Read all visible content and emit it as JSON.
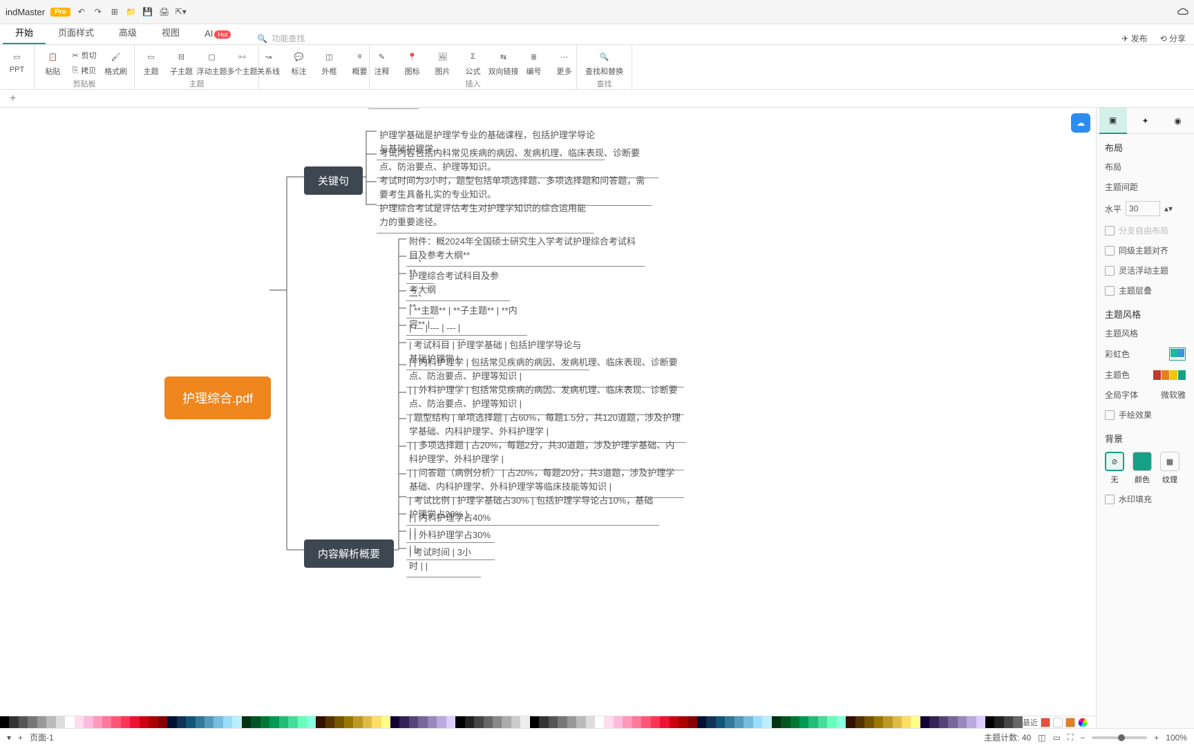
{
  "app": {
    "name": "indMaster",
    "badge": "Pro"
  },
  "menutabs": [
    "开始",
    "页面样式",
    "高级",
    "视图",
    "AI"
  ],
  "menuactive": 0,
  "ai_hot": "Hot",
  "search_placeholder": "功能查找",
  "share": {
    "publish": "发布",
    "share": "分享"
  },
  "ribbon": {
    "ppt": "PPT",
    "paste": "粘贴",
    "cut": "剪切",
    "copy": "拷贝",
    "format": "格式刷",
    "topic": "主题",
    "subtopic": "子主题",
    "float": "浮动主题",
    "multi": "多个主题",
    "relation": "关系线",
    "callout": "标注",
    "boundary": "外框",
    "summary": "概要",
    "note": "注释",
    "iconm": "图标",
    "image": "图片",
    "formula": "公式",
    "hyperlink": "双向链接",
    "number": "编号",
    "more": "更多",
    "find": "查找和替换",
    "g_clip": "剪贴板",
    "g_topic": "主题",
    "g_insert": "插入",
    "g_find": "查找"
  },
  "mind": {
    "root": "护理综合.pdf",
    "branch1": "关键句",
    "branch1_leaves": [
      "护理学基础是护理学专业的基础课程，包括护理学导论与基础护理学。",
      "考试内容包括内科常见疾病的病因、发病机理、临床表现、诊断要点、防治要点、护理等知识。",
      "考试时间为3小时，题型包括单项选择题、多项选择题和问答题，需要考生具备扎实的专业知识。",
      "护理综合考试是评估考生对护理学知识的综合运用能力的重要途径。"
    ],
    "branch2": "内容解析概要",
    "branch2_leaves": [
      "附件：概2024年全国硕士研究生入学考试护理综合考试科目及参考大纲**",
      "一、**",
      "护理综合考试科目及参考大纲",
      "二、**",
      "| **主题** | **子主题** | **内容** |",
      "| --- | --- | --- |",
      "| 考试科目 | 护理学基础 | 包括护理学导论与基础护理学 |",
      "|  | 内科护理学 | 包括常见疾病的病因、发病机理、临床表现、诊断要点、防治要点、护理等知识 |",
      "|  | 外科护理学 | 包括常见疾病的病因、发病机理、临床表现、诊断要点、防治要点、护理等知识 |",
      "| 题型结构 | 单项选择题 | 占60%，每题1.5分，共120道题，涉及护理学基础、内科护理学、外科护理学 |",
      "|  | 多项选择题 | 占20%，每题2分，共30道题，涉及护理学基础、内科护理学、外科护理学 |",
      "|  | 问答题（病例分析） | 占20%，每题20分，共3道题，涉及护理学基础、内科护理学、外科护理学等临床技能等知识 |",
      "| 考试比例 | 护理学基础占30% | 包括护理学导论占10%，基础护理学占20% |",
      "|  | 内科护理学占40% |  |",
      "|  | 外科护理学占30% |  |",
      "| 考试时间 | 3小时 |  |"
    ]
  },
  "rpanel": {
    "layout_title": "布局",
    "layout_sub": "布局",
    "spacing": "主题间距",
    "horiz": "水平",
    "horiz_val": "30",
    "free": "分支自由布局",
    "align": "同级主题对齐",
    "flex": "灵活浮动主题",
    "stack": "主题层叠",
    "style_title": "主题风格",
    "style_sub": "主题风格",
    "rainbow": "彩虹色",
    "theme_color": "主题色",
    "font": "全局字体",
    "font_val": "微软雅",
    "hand": "手绘效果",
    "bg_title": "背景",
    "bg_none": "无",
    "bg_color": "颜色",
    "bg_texture": "纹理",
    "watermark": "水印填充"
  },
  "status": {
    "page": "页面-1",
    "recent": "最近",
    "count_label": "主题计数:",
    "count": "40",
    "zoom": "100%"
  },
  "colors": [
    "#000",
    "#333",
    "#555",
    "#777",
    "#999",
    "#bbb",
    "#ddd",
    "#fff",
    "#fde",
    "#fbd",
    "#f9b",
    "#f79",
    "#f57",
    "#f35",
    "#e13",
    "#c01",
    "#a00",
    "#800",
    "#013",
    "#135",
    "#157",
    "#379",
    "#59b",
    "#7bd",
    "#9df",
    "#bef",
    "#031",
    "#052",
    "#073",
    "#095",
    "#2b7",
    "#4d9",
    "#6fb",
    "#8fd",
    "#310",
    "#530",
    "#750",
    "#970",
    "#b92",
    "#db4",
    "#fd6",
    "#ff8",
    "#103",
    "#325",
    "#547",
    "#769",
    "#98b",
    "#bad",
    "#dcf",
    "#000",
    "#222",
    "#444",
    "#666",
    "#888",
    "#aaa",
    "#ccc",
    "#eee"
  ]
}
